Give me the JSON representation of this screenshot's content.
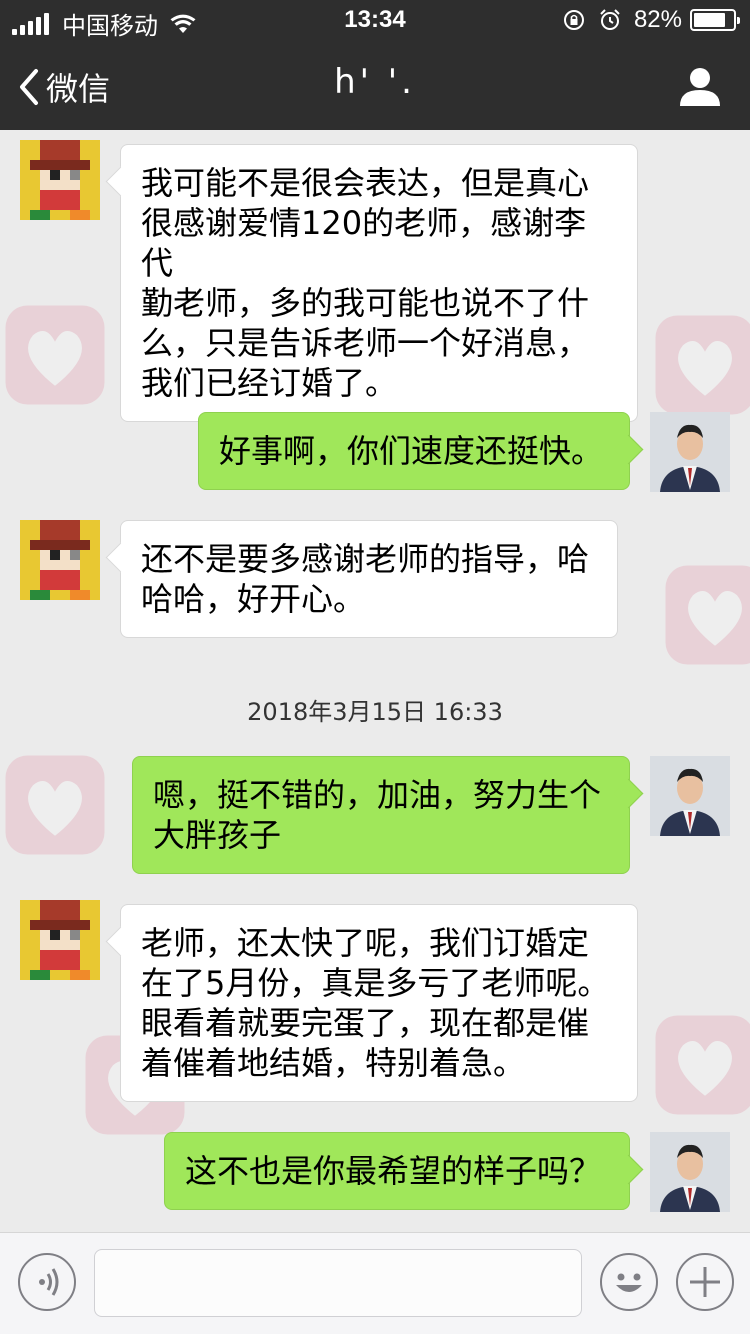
{
  "status_bar": {
    "carrier": "中国移动",
    "time": "13:34",
    "battery_percent_label": "82%",
    "battery_level": 0.82,
    "icons": [
      "signal-icon",
      "wifi-icon",
      "rotation-lock-icon",
      "alarm-icon",
      "battery-icon"
    ]
  },
  "nav": {
    "back_label": "微信",
    "title": "h' '.",
    "profile_icon": "person-icon"
  },
  "messages": [
    {
      "side": "in",
      "text_lines": [
        "我可能不是很会表达，但是真心",
        "很感谢爱情120的老师，感谢李代",
        "勤老师，多的我可能也说不了什",
        "么，只是告诉老师一个好消息，",
        "我们已经订婚了。"
      ]
    },
    {
      "side": "out",
      "text_lines": [
        "好事啊，你们速度还挺快。"
      ]
    },
    {
      "side": "in",
      "text_lines": [
        "还不是要多感谢老师的指导，哈",
        "哈哈，好开心。"
      ]
    },
    {
      "side": "out",
      "text_lines": [
        "嗯，挺不错的，加油，努力生个",
        "大胖孩子"
      ]
    },
    {
      "side": "in",
      "text_lines": [
        "老师，还太快了呢，我们订婚定",
        "在了5月份，真是多亏了老师呢。",
        "眼看着就要完蛋了，现在都是催",
        "着催着地结婚，特别着急。"
      ]
    },
    {
      "side": "out",
      "text_lines": [
        "这不也是你最希望的样子吗？"
      ]
    }
  ],
  "timestamp": "2018年3月15日 16:33",
  "input_bar": {
    "placeholder": "",
    "icons": [
      "voice-icon",
      "emoji-icon",
      "plus-icon"
    ]
  },
  "colors": {
    "nav_bg": "#2e2e2e",
    "chat_bg": "#ebebeb",
    "bubble_out": "#a0e75a",
    "bubble_in": "#ffffff"
  }
}
